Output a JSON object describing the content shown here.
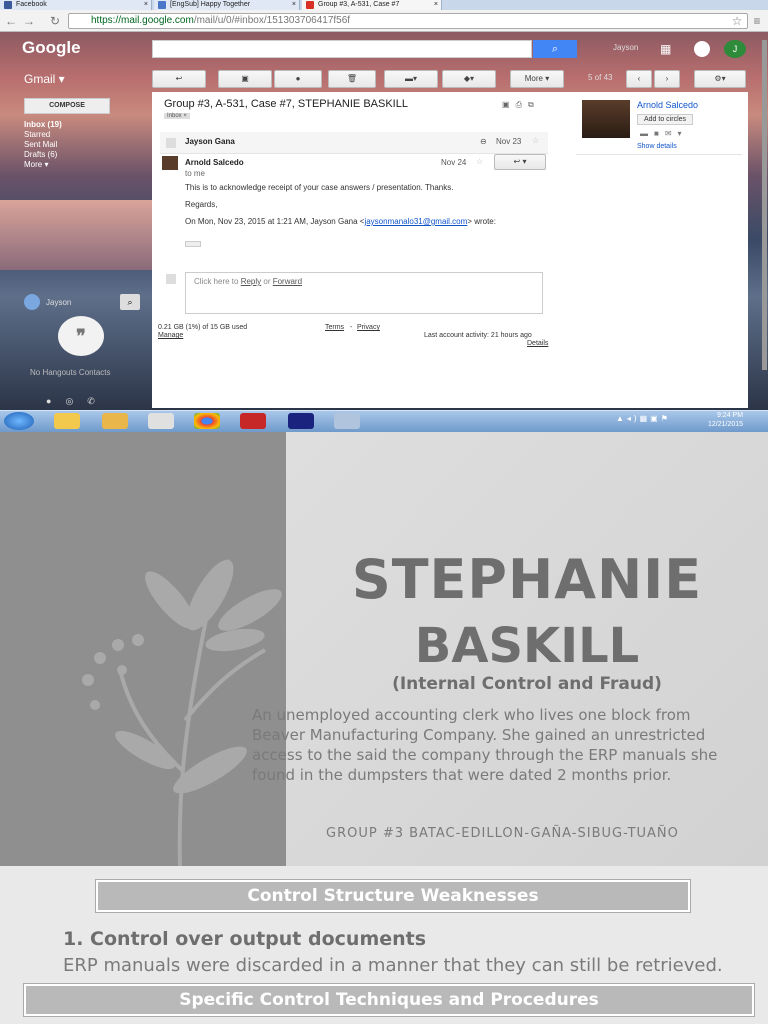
{
  "browser": {
    "tabs": [
      {
        "label": "Facebook",
        "color": "#3b5998"
      },
      {
        "label": "[EngSub] Happy Together",
        "color": "#4a76c9"
      },
      {
        "label": "Group #3, A-531, Case #7",
        "color": "#d93025"
      }
    ],
    "url_host": "https://mail.google.com",
    "url_path": "/mail/u/0/#inbox/151303706417f56f",
    "tab_close": "×"
  },
  "gmail": {
    "logo": "Google",
    "app_label": "Gmail ▾",
    "user_short": "Jayson",
    "avatar_letter": "J",
    "pager": "5 of 43",
    "more_label": "More ▾",
    "compose": "COMPOSE",
    "nav": [
      "Inbox (19)",
      "Starred",
      "Sent Mail",
      "Drafts (6)",
      "More ▾"
    ],
    "chat_user": "Jayson",
    "no_hangouts": "No Hangouts Contacts",
    "subject": "Group #3, A-531, Case #7, STEPHANIE BASKILL",
    "label_tag": "Inbox ×",
    "msg1_from": "Jayson Gana",
    "msg1_date": "Nov 23",
    "msg2_from": "Arnold Salcedo",
    "msg2_date": "Nov 24",
    "msg2_to": "to me",
    "body_line1": "This is to acknowledge receipt of your case answers / presentation. Thanks.",
    "body_line2": "Regards,",
    "body_quote": "On Mon, Nov 23, 2015 at 1:21 AM, Jayson Gana <",
    "body_email": "jaysonmanalo31@gmail.com",
    "body_quote_end": "> wrote:",
    "reply_prefix": "Click here to ",
    "reply_link": "Reply",
    "reply_or": " or ",
    "forward_link": "Forward",
    "storage": "0.21 GB (1%) of 15 GB used",
    "manage": "Manage",
    "terms": "Terms",
    "privacy": "Privacy",
    "activity": "Last account activity: 21 hours ago",
    "details": "Details",
    "contact_name": "Arnold Salcedo",
    "add_circles": "Add to circles",
    "show_details": "Show details"
  },
  "taskbar": {
    "time": "9:24 PM",
    "date": "12/21/2015"
  },
  "slide": {
    "title1": "STEPHANIE",
    "title2": "BASKILL",
    "subtitle": "(Internal Control and Fraud)",
    "para": [
      "An unemployed accounting clerk who lives one block from",
      "Beaver Manufacturing Company. She gained an unrestricted",
      "access to the said the company through the ERP manuals she",
      "found in the dumpsters that were dated 2 months prior."
    ],
    "group": "GROUP #3    BATAC-EDILLON-GAÑA-SIBUG-TUAÑO",
    "section1": "Control Structure Weaknesses",
    "item1_title": "1. Control over output documents",
    "item1_text": "ERP manuals were discarded in a manner that they can still be retrieved.",
    "section2": "Specific Control Techniques and Procedures"
  }
}
